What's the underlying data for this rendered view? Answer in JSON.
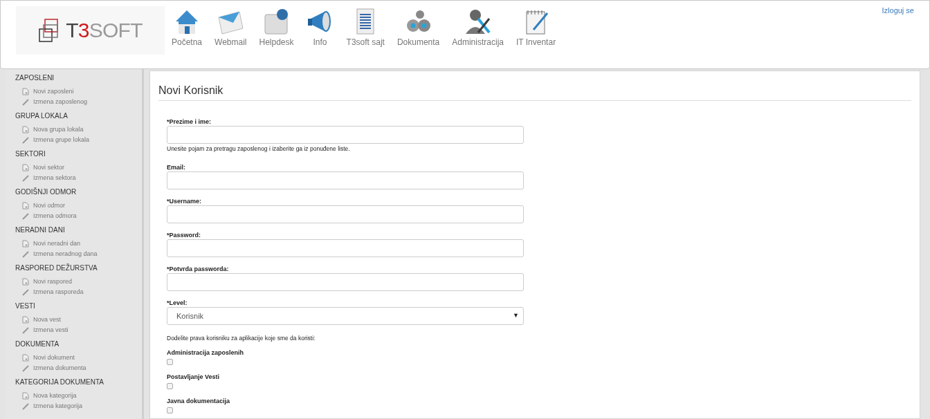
{
  "header": {
    "logo": {
      "prefix": "T",
      "highlight": "3",
      "suffix": "SOFT"
    },
    "nav": [
      {
        "label": "Početna"
      },
      {
        "label": "Webmail"
      },
      {
        "label": "Helpdesk"
      },
      {
        "label": "Info"
      },
      {
        "label": "T3soft sajt"
      },
      {
        "label": "Dokumenta"
      },
      {
        "label": "Administracija"
      },
      {
        "label": "IT Inventar"
      }
    ],
    "logout": "Izloguj se"
  },
  "sidebar": {
    "sections": [
      {
        "title": "ZAPOSLENI",
        "items": [
          {
            "label": "Novi zaposleni",
            "kind": "new"
          },
          {
            "label": "Izmena zaposlenog",
            "kind": "edit"
          }
        ]
      },
      {
        "title": "GRUPA LOKALA",
        "items": [
          {
            "label": "Nova grupa lokala",
            "kind": "new"
          },
          {
            "label": "Izmena grupe lokala",
            "kind": "edit"
          }
        ]
      },
      {
        "title": "SEKTORI",
        "items": [
          {
            "label": "Novi sektor",
            "kind": "new"
          },
          {
            "label": "Izmena sektora",
            "kind": "edit"
          }
        ]
      },
      {
        "title": "GODIŠNJI ODMOR",
        "items": [
          {
            "label": "Novi odmor",
            "kind": "new"
          },
          {
            "label": "Izmena odmora",
            "kind": "edit"
          }
        ]
      },
      {
        "title": "NERADNI DANI",
        "items": [
          {
            "label": "Novi neradni dan",
            "kind": "new"
          },
          {
            "label": "Izmena neradnog dana",
            "kind": "edit"
          }
        ]
      },
      {
        "title": "RASPORED DEŽURSTVA",
        "items": [
          {
            "label": "Novi raspored",
            "kind": "new"
          },
          {
            "label": "Izmena rasporeda",
            "kind": "edit"
          }
        ]
      },
      {
        "title": "VESTI",
        "items": [
          {
            "label": "Nova vest",
            "kind": "new"
          },
          {
            "label": "Izmena vesti",
            "kind": "edit"
          }
        ]
      },
      {
        "title": "DOKUMENTA",
        "items": [
          {
            "label": "Novi dokument",
            "kind": "new"
          },
          {
            "label": "Izmena dokumenta",
            "kind": "edit"
          }
        ]
      },
      {
        "title": "KATEGORIJA DOKUMENTA",
        "items": [
          {
            "label": "Nova kategorija",
            "kind": "new"
          },
          {
            "label": "Izmena kategorija",
            "kind": "edit"
          }
        ]
      }
    ]
  },
  "form": {
    "title": "Novi Korisnik",
    "fields": [
      {
        "kind": "text",
        "label": "*Prezime i ime:",
        "help": "Unesite pojam za pretragu zaposlenog i izaberite ga iz ponuđene liste."
      },
      {
        "kind": "text",
        "label": "Email:"
      },
      {
        "kind": "text",
        "label": "*Username:"
      },
      {
        "kind": "text",
        "label": "*Password:"
      },
      {
        "kind": "text",
        "label": "*Potvrda passworda:"
      },
      {
        "kind": "select",
        "label": "*Level:",
        "value": "Korisnik",
        "arrow": "▼"
      }
    ],
    "rights_intro": "Dodelite prava korisniku za aplikacije koje sme da koristi:",
    "rights": [
      {
        "label": "Administracija zaposlenih",
        "checked": false
      },
      {
        "label": "Postavljanje Vesti",
        "checked": false
      },
      {
        "label": "Javna dokumentacija",
        "checked": false
      }
    ]
  }
}
